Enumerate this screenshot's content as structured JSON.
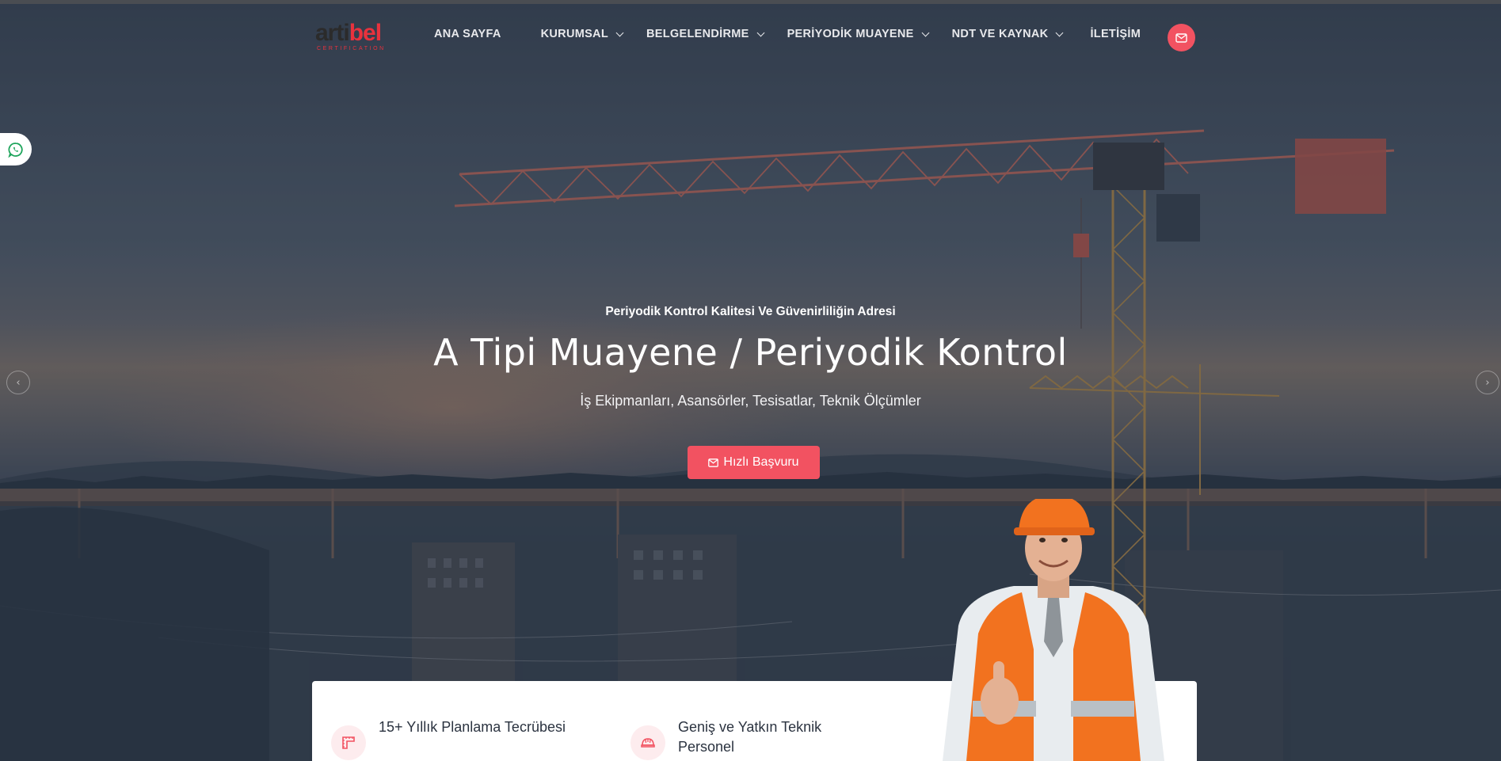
{
  "header": {
    "logo": {
      "part1": "arti",
      "part2": "bel",
      "tagline": "CERTIFICATION"
    },
    "nav": [
      {
        "label": "ANA SAYFA",
        "has_dropdown": false
      },
      {
        "label": "KURUMSAL",
        "has_dropdown": true
      },
      {
        "label": "BELGELENDİRME",
        "has_dropdown": true
      },
      {
        "label": "PERİYODİK MUAYENE",
        "has_dropdown": true
      },
      {
        "label": "NDT VE KAYNAK",
        "has_dropdown": true
      },
      {
        "label": "İLETİŞİM",
        "has_dropdown": false
      }
    ],
    "mail_icon": "envelope-icon"
  },
  "side": {
    "whatsapp_icon": "whatsapp-icon"
  },
  "slider": {
    "prev_icon": "chevron-left-icon",
    "next_icon": "chevron-right-icon",
    "prev": "‹",
    "next": "›"
  },
  "hero": {
    "subtitle": "Periyodik Kontrol Kalitesi Ve Güvenirliliğin Adresi",
    "title": "A Tipi Muayene / Periyodik Kontrol",
    "description": "İş Ekipmanları, Asansörler, Tesisatlar, Teknik Ölçümler",
    "cta_label": "Hızlı Başvuru"
  },
  "features": [
    {
      "icon": "ruler-icon",
      "text": "15+ Yıllık Planlama Tecrübesi"
    },
    {
      "icon": "hard-hat-icon",
      "text_line1": "Geniş ve Yatkın Teknik",
      "text_line2": "Personel"
    }
  ],
  "colors": {
    "accent": "#f25261",
    "brand_red": "#e8323d"
  }
}
